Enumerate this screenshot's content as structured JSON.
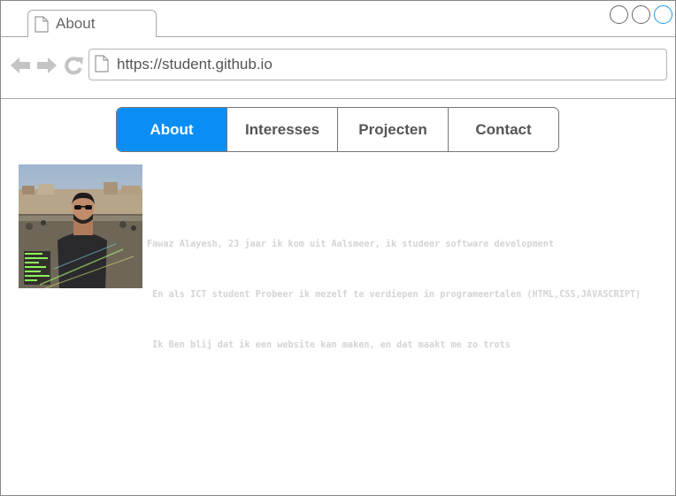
{
  "browser": {
    "tab_title": "About",
    "url": "https://student.github.io"
  },
  "nav": {
    "items": [
      {
        "label": "About",
        "active": true
      },
      {
        "label": "Interesses",
        "active": false
      },
      {
        "label": "Projecten",
        "active": false
      },
      {
        "label": "Contact",
        "active": false
      }
    ]
  },
  "profile": {
    "bio_lines": [
      "Fawaz Alayesh, 23 jaar ik kom uit Aalsmeer, ik studeer software development",
      " En als ICT student Probeer ik mezelf te verdiepen in programeertalen (HTML,CSS,JAVASCRIPT)",
      " Ik Ben blij dat ik een website kan maken, en dat maakt me zo trots"
    ]
  },
  "colors": {
    "accent": "#0a8ef5",
    "window_button_active": "#1a9cf0",
    "bio_text": "#d4d4d4"
  },
  "icons": [
    "document-icon",
    "back-arrow-icon",
    "forward-arrow-icon",
    "reload-icon",
    "window-circle-icon"
  ]
}
